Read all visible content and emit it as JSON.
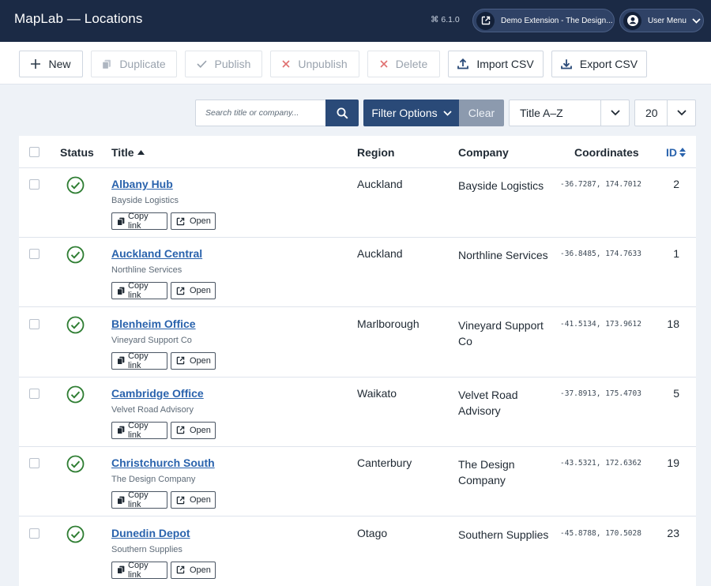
{
  "header": {
    "app_title": "MapLab — Locations",
    "version": "⌘ 6.1.0",
    "extension_label": "Demo Extension - The Design...",
    "user_menu_label": "User Menu"
  },
  "toolbar": {
    "new": "New",
    "duplicate": "Duplicate",
    "publish": "Publish",
    "unpublish": "Unpublish",
    "delete": "Delete",
    "import_csv": "Import CSV",
    "export_csv": "Export CSV"
  },
  "filters": {
    "search_placeholder": "Search title or company...",
    "filter_options": "Filter Options",
    "clear": "Clear",
    "sort_value": "Title A–Z",
    "limit_value": "20"
  },
  "table": {
    "columns": {
      "status": "Status",
      "title": "Title",
      "region": "Region",
      "company": "Company",
      "coordinates": "Coordinates",
      "id": "ID"
    },
    "actions": {
      "copy_link": "Copy link",
      "open": "Open"
    },
    "rows": [
      {
        "title": "Albany Hub",
        "subtitle": "Bayside Logistics",
        "region": "Auckland",
        "company": "Bayside Logistics",
        "coords": "-36.7287, 174.7012",
        "id": "2",
        "status": "published"
      },
      {
        "title": "Auckland Central",
        "subtitle": "Northline Services",
        "region": "Auckland",
        "company": "Northline Services",
        "coords": "-36.8485, 174.7633",
        "id": "1",
        "status": "published"
      },
      {
        "title": "Blenheim Office",
        "subtitle": "Vineyard Support Co",
        "region": "Marlborough",
        "company": "Vineyard Support Co",
        "coords": "-41.5134, 173.9612",
        "id": "18",
        "status": "published"
      },
      {
        "title": "Cambridge Office",
        "subtitle": "Velvet Road Advisory",
        "region": "Waikato",
        "company": "Velvet Road Advisory",
        "coords": "-37.8913, 175.4703",
        "id": "5",
        "status": "published"
      },
      {
        "title": "Christchurch South",
        "subtitle": "The Design Company",
        "region": "Canterbury",
        "company": "The Design Company",
        "coords": "-43.5321, 172.6362",
        "id": "19",
        "status": "published"
      },
      {
        "title": "Dunedin Depot",
        "subtitle": "Southern Supplies",
        "region": "Otago",
        "company": "Southern Supplies",
        "coords": "-45.8788, 170.5028",
        "id": "23",
        "status": "published"
      }
    ]
  },
  "colors": {
    "header_bg": "#1b2a45",
    "primary": "#2a4a78",
    "link": "#2a63ad",
    "published": "#2e7d32"
  }
}
